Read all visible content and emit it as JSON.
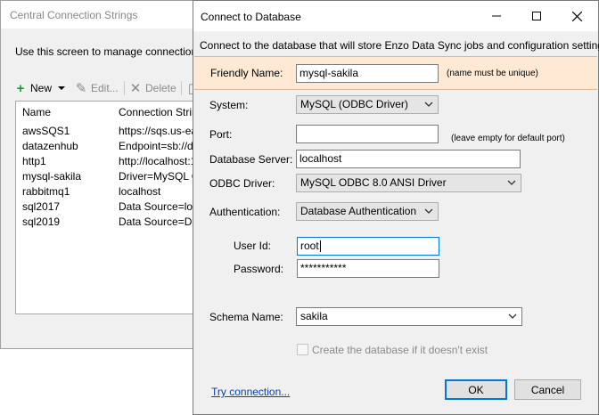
{
  "bg_window": {
    "title": "Central Connection Strings",
    "description": "Use this screen to manage connection stri",
    "toolbar": {
      "new": "New",
      "edit": "Edit...",
      "delete": "Delete"
    },
    "columns": [
      "Name",
      "Connection String"
    ],
    "rows": [
      {
        "name": "awsSQS1",
        "conn": "https://sqs.us-eas"
      },
      {
        "name": "datazenhub",
        "conn": "Endpoint=sb://da"
      },
      {
        "name": "http1",
        "conn": "http://localhost:1"
      },
      {
        "name": "mysql-sakila",
        "conn": "Driver=MySQL OD"
      },
      {
        "name": "rabbitmq1",
        "conn": "localhost"
      },
      {
        "name": "sql2017",
        "conn": "Data Source=loca"
      },
      {
        "name": "sql2019",
        "conn": "Data Source=DEV"
      }
    ]
  },
  "dialog": {
    "title": "Connect to Database",
    "intro": "Connect to the database that will store Enzo Data Sync jobs and configuration settings.",
    "friendly_name": {
      "label": "Friendly Name:",
      "value": "mysql-sakila",
      "hint": "(name must be unique)"
    },
    "system": {
      "label": "System:",
      "value": "MySQL (ODBC Driver)"
    },
    "port": {
      "label": "Port:",
      "value": "",
      "hint": "(leave empty for default port)"
    },
    "server": {
      "label": "Database Server:",
      "value": "localhost"
    },
    "odbc_driver": {
      "label": "ODBC Driver:",
      "value": "MySQL ODBC 8.0 ANSI Driver"
    },
    "authentication": {
      "label": "Authentication:",
      "value": "Database Authentication"
    },
    "user_id": {
      "label": "User Id:",
      "value": "root"
    },
    "password": {
      "label": "Password:",
      "value": "***********"
    },
    "schema": {
      "label": "Schema Name:",
      "value": "sakila"
    },
    "create_db": {
      "label": "Create the database if it doesn't exist",
      "checked": false
    },
    "try_connection": "Try connection...",
    "ok": "OK",
    "cancel": "Cancel"
  },
  "colors": {
    "accent": "#0078d7",
    "band": "#fde9d4",
    "link": "#0645ad",
    "add_green": "#1d9b3a"
  }
}
